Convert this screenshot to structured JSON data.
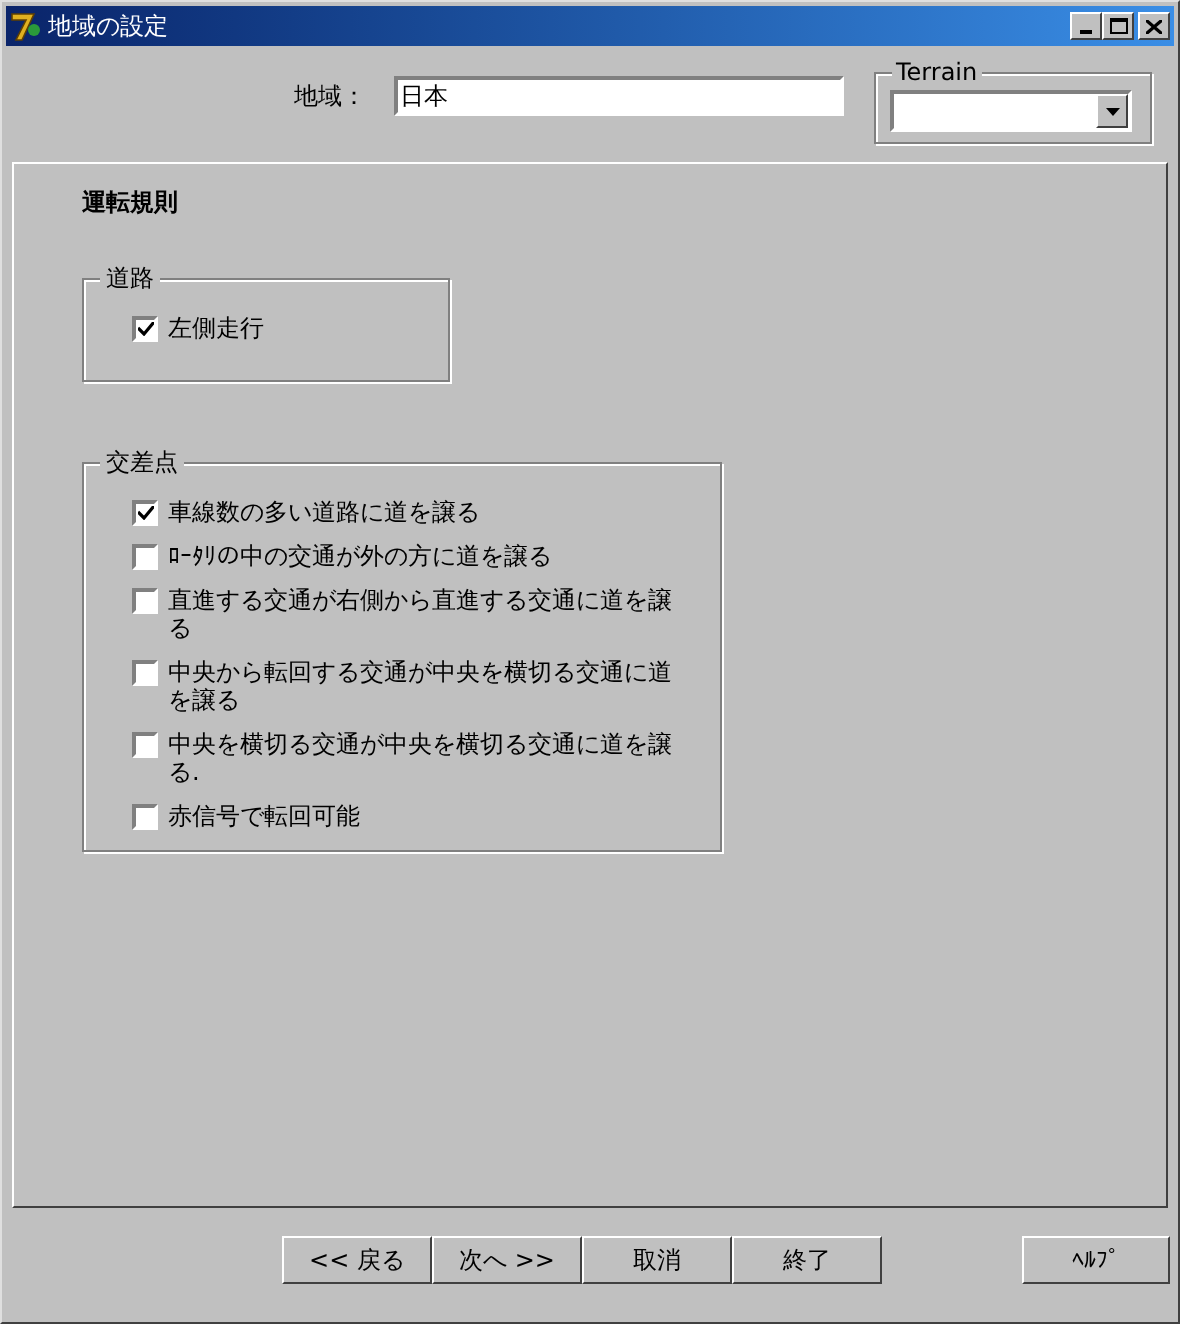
{
  "window": {
    "title": "地域の設定"
  },
  "region": {
    "label": "地域：",
    "value": "日本"
  },
  "terrain": {
    "label": "Terrain"
  },
  "panel": {
    "title": "運転規則",
    "groups": [
      {
        "title": "道路",
        "options": [
          {
            "label": "左側走行",
            "checked": true
          }
        ]
      },
      {
        "title": "交差点",
        "options": [
          {
            "label": "車線数の多い道路に道を譲る",
            "checked": true
          },
          {
            "label": "ﾛｰﾀﾘの中の交通が外の方に道を譲る",
            "checked": false
          },
          {
            "label": "直進する交通が右側から直進する交通に道を譲る",
            "checked": false
          },
          {
            "label": "中央から転回する交通が中央を横切る交通に道を譲る",
            "checked": false
          },
          {
            "label": "中央を横切る交通が中央を横切る交通に道を譲る.",
            "checked": false
          },
          {
            "label": "赤信号で転回可能",
            "checked": false
          }
        ]
      }
    ]
  },
  "buttons": [
    "<< 戻る",
    "次へ >>",
    "取消",
    "終了"
  ],
  "help_button": "ﾍﾙﾌﾟ"
}
